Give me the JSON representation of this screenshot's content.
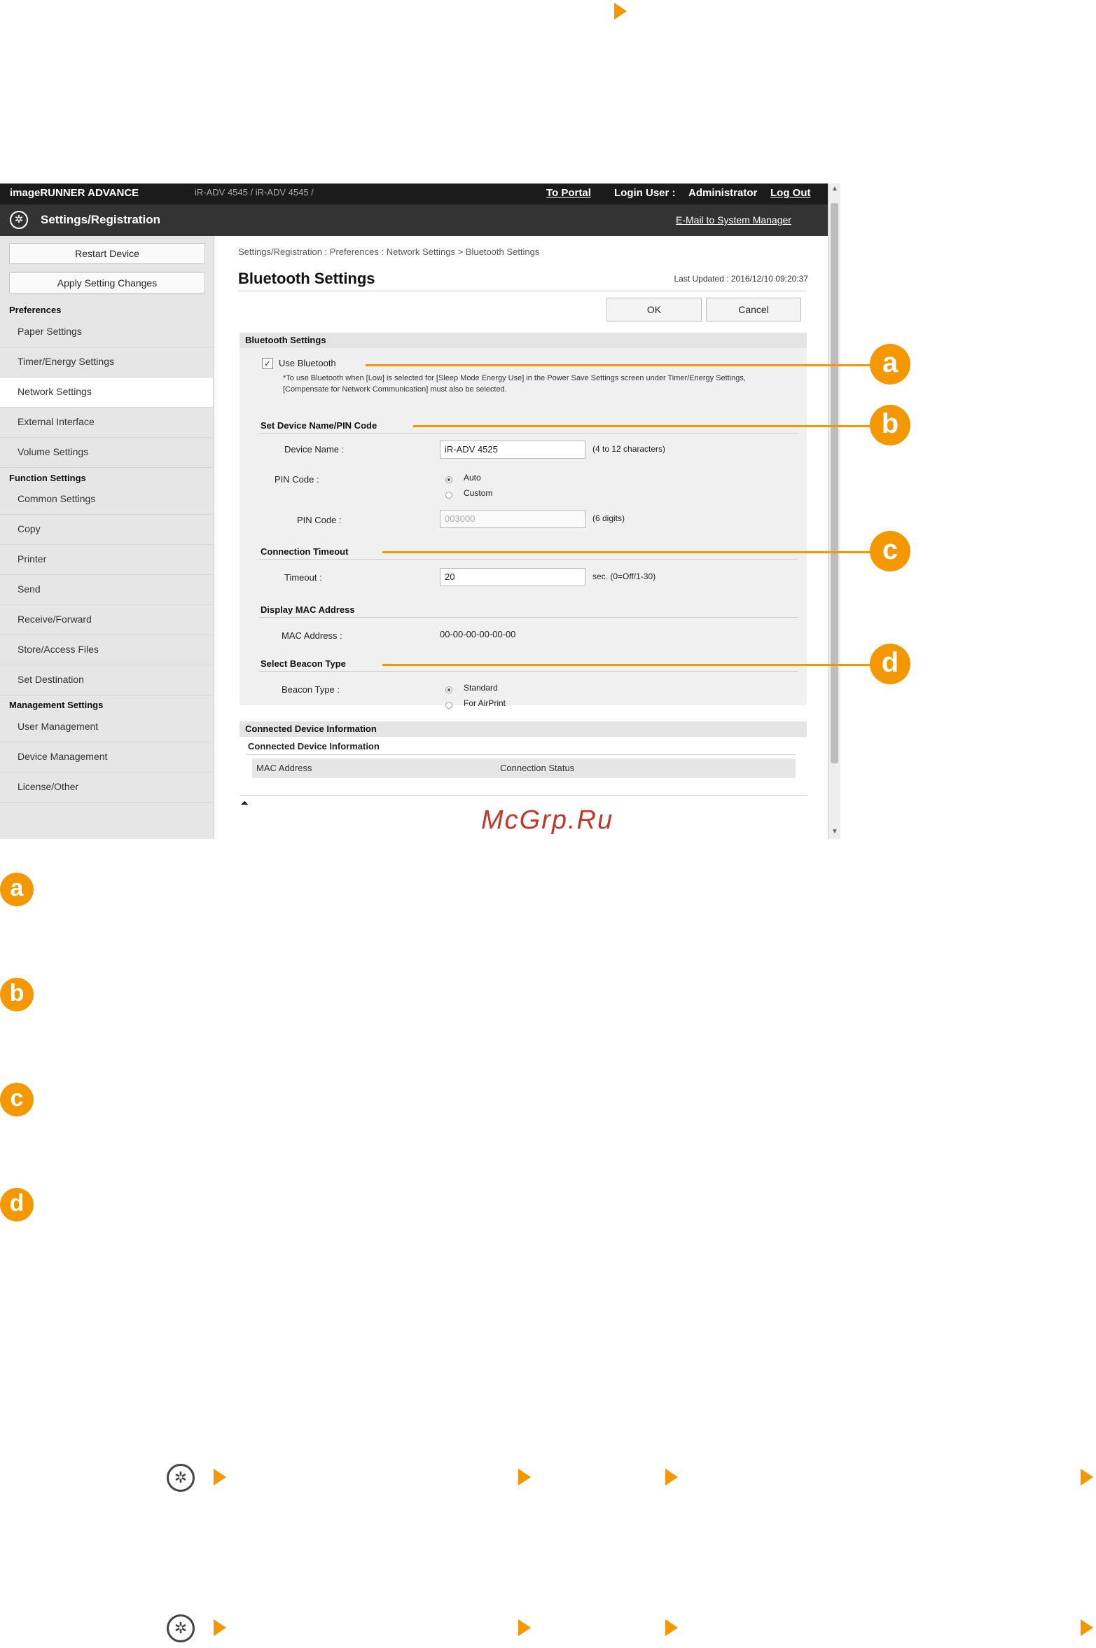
{
  "app": {
    "product": "imageRUNNER ADVANCE",
    "model": "iR-ADV 4545 / iR-ADV 4545 /",
    "title": "Settings/Registration",
    "to_portal": "To Portal",
    "login_user_label": "Login User :",
    "login_user": "Administrator",
    "logout": "Log Out",
    "email_manager": "E-Mail to System Manager"
  },
  "sidebar": {
    "restart": "Restart Device",
    "apply": "Apply Setting Changes",
    "groups": [
      {
        "heading": "Preferences",
        "items": [
          "Paper Settings",
          "Timer/Energy Settings",
          "Network Settings",
          "External Interface",
          "Volume Settings"
        ]
      },
      {
        "heading": "Function Settings",
        "items": [
          "Common Settings",
          "Copy",
          "Printer",
          "Send",
          "Receive/Forward",
          "Store/Access Files",
          "Set Destination"
        ]
      },
      {
        "heading": "Management Settings",
        "items": [
          "User Management",
          "Device Management",
          "License/Other"
        ]
      }
    ],
    "active_item": "Network Settings"
  },
  "main": {
    "breadcrumb": "Settings/Registration : Preferences : Network Settings > Bluetooth Settings",
    "title": "Bluetooth Settings",
    "last_updated": "Last Updated : 2016/12/10 09:20:37",
    "ok": "OK",
    "cancel": "Cancel",
    "section_title": "Bluetooth Settings",
    "use_bluetooth": "Use Bluetooth",
    "use_bluetooth_checked": true,
    "note": "*To use Bluetooth when [Low] is selected for [Sleep Mode Energy Use] in the Power Save Settings screen under Timer/Energy Settings, [Compensate for Network Communication] must also be selected.",
    "device_name_heading": "Set Device Name/PIN Code",
    "device_name_label": "Device Name :",
    "device_name_value": "iR-ADV 4525",
    "device_name_hint": "(4 to 12 characters)",
    "pin_mode_label": "PIN Code :",
    "pin_auto": "Auto",
    "pin_custom": "Custom",
    "pin_selected": "Auto",
    "pin_code_label": "PIN Code :",
    "pin_code_value": "003000",
    "pin_code_hint": "(6 digits)",
    "timeout_heading": "Connection Timeout",
    "timeout_label": "Timeout :",
    "timeout_value": "20",
    "timeout_hint": "sec. (0=Off/1-30)",
    "mac_heading": "Display MAC Address",
    "mac_label": "MAC Address :",
    "mac_value": "00-00-00-00-00-00",
    "beacon_heading": "Select Beacon Type",
    "beacon_label": "Beacon Type :",
    "beacon_standard": "Standard",
    "beacon_airprint": "For AirPrint",
    "beacon_selected": "Standard",
    "connected_section": "Connected Device Information",
    "connected_sub": "Connected Device Information",
    "col_mac": "MAC Address",
    "col_status": "Connection Status"
  },
  "callouts": [
    "a",
    "b",
    "c",
    "d"
  ],
  "watermark": "McGrp.Ru",
  "colors": {
    "accent": "#f39800"
  }
}
